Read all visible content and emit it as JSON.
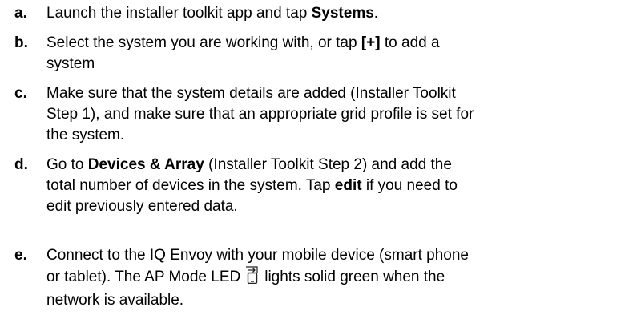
{
  "steps": [
    {
      "letter": "a.",
      "text_1": "Launch the installer toolkit app and tap ",
      "bold_1": "Systems",
      "text_2": "."
    },
    {
      "letter": "b.",
      "text_1": "Select the system you are working with, or tap ",
      "bold_1": "[+]",
      "text_2": " to add a",
      "text_3": "system"
    },
    {
      "letter": "c.",
      "line_1": "Make sure that the system details are added (Installer Toolkit",
      "line_2": "Step 1), and make sure that an appropriate grid profile is set for",
      "line_3": "the system."
    },
    {
      "letter": "d.",
      "text_1": "Go to ",
      "bold_1": "Devices & Array",
      "text_2": " (Installer Toolkit Step 2) and add the",
      "line_2": "total number of devices in the system. Tap ",
      "bold_2": "edit",
      "text_3": " if you need to",
      "line_3": "edit previously entered data."
    },
    {
      "letter": "e.",
      "line_1": "Connect to the IQ Envoy with your mobile device (smart phone",
      "line_2a": "or tablet). The AP Mode LED",
      "line_2b": "lights solid green when the",
      "line_3": "network is available.",
      "icon": "ap-mode-led-icon"
    }
  ]
}
